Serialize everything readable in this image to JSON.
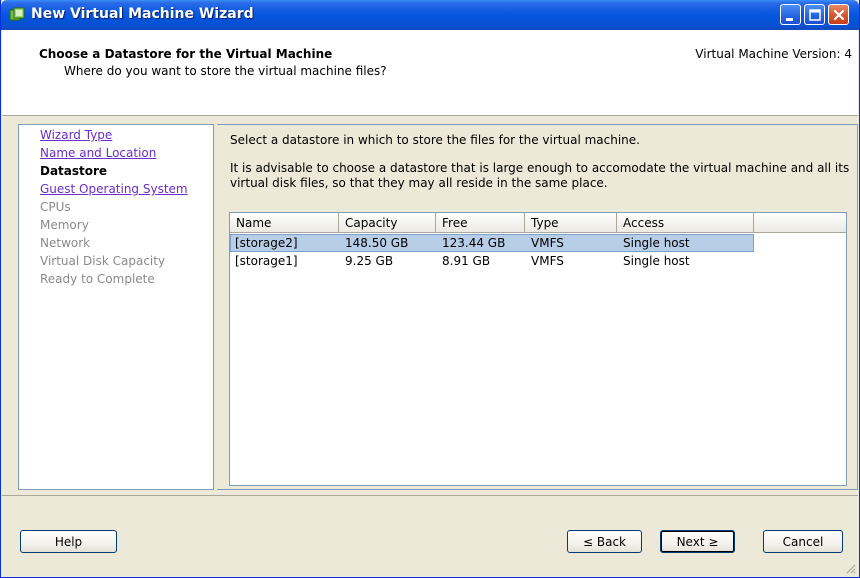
{
  "window": {
    "title": "New Virtual Machine Wizard"
  },
  "header": {
    "title": "Choose a Datastore for the Virtual Machine",
    "subtitle": "Where do you want to store the virtual machine files?",
    "version": "Virtual Machine Version: 4"
  },
  "steps": [
    {
      "label": "Wizard Type",
      "state": "link"
    },
    {
      "label": "Name and Location",
      "state": "link"
    },
    {
      "label": "Datastore",
      "state": "current"
    },
    {
      "label": "Guest Operating System",
      "state": "link"
    },
    {
      "label": "CPUs",
      "state": "disabled"
    },
    {
      "label": "Memory",
      "state": "disabled"
    },
    {
      "label": "Network",
      "state": "disabled"
    },
    {
      "label": "Virtual Disk Capacity",
      "state": "disabled"
    },
    {
      "label": "Ready to Complete",
      "state": "disabled"
    }
  ],
  "content": {
    "instruction": "Select a datastore in which to store the files for the virtual machine.",
    "advice_line1": "It is advisable to choose a datastore that is large enough to accomodate the virtual machine and all its",
    "advice_line2": "virtual disk files, so that they may all reside in the same place."
  },
  "table": {
    "columns": [
      "Name",
      "Capacity",
      "Free",
      "Type",
      "Access"
    ],
    "rows": [
      {
        "name": "[storage2]",
        "capacity": "148.50 GB",
        "free": "123.44 GB",
        "type": "VMFS",
        "access": "Single host",
        "selected": true
      },
      {
        "name": "[storage1]",
        "capacity": "9.25 GB",
        "free": "8.91 GB",
        "type": "VMFS",
        "access": "Single host",
        "selected": false
      }
    ]
  },
  "buttons": {
    "help": "Help",
    "back": "≤ Back",
    "next": "Next ≥",
    "cancel": "Cancel"
  },
  "colors": {
    "titlebar": "#0553d8",
    "link": "#6a2fc9",
    "selection": "#b8cde6",
    "disabled_text": "#8a8a8a"
  }
}
